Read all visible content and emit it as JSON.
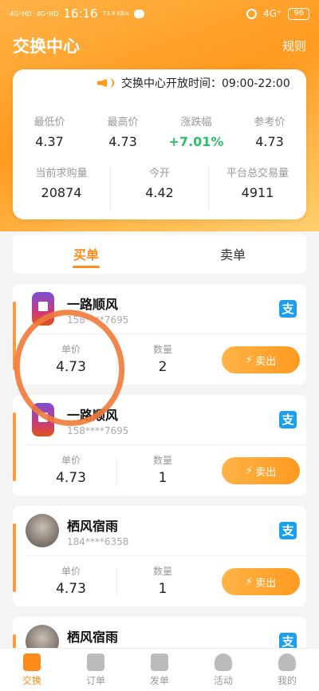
{
  "status": {
    "net1": "4G⁺HD",
    "net2": "4G⁺HD",
    "time": "16:16",
    "speed": "73.9 KB/s",
    "net3": "4G⁺",
    "battery": "96"
  },
  "header": {
    "title": "交换中心",
    "rules": "规则"
  },
  "notice": "交换中心开放时间：09:00-22:00",
  "stats": {
    "row1": [
      {
        "label": "最低价",
        "value": "4.37"
      },
      {
        "label": "最高价",
        "value": "4.73"
      },
      {
        "label": "涨跌幅",
        "value": "+7.01%"
      },
      {
        "label": "参考价",
        "value": "4.73"
      }
    ],
    "row2": [
      {
        "label": "当前求购量",
        "value": "20874"
      },
      {
        "label": "今开",
        "value": "4.42"
      },
      {
        "label": "平台总交易量",
        "value": "4911"
      }
    ]
  },
  "tabs": {
    "buy": "买单",
    "sell": "卖单"
  },
  "orders": [
    {
      "name": "一路顺风",
      "id": "158****7695",
      "price_label": "单价",
      "price": "4.73",
      "qty_label": "数量",
      "qty": "2",
      "action": "卖出",
      "pay_icon": "支"
    },
    {
      "name": "一路顺风",
      "id": "158****7695",
      "price_label": "单价",
      "price": "4.73",
      "qty_label": "数量",
      "qty": "1",
      "action": "卖出",
      "pay_icon": "支"
    },
    {
      "name": "栖风宿雨",
      "id": "184****6358",
      "price_label": "单价",
      "price": "4.73",
      "qty_label": "数量",
      "qty": "1",
      "action": "卖出",
      "pay_icon": "支"
    },
    {
      "name": "栖风宿雨",
      "id": "",
      "pay_icon": "支"
    }
  ],
  "tabbar": [
    {
      "label": "交换"
    },
    {
      "label": "订单"
    },
    {
      "label": "发单"
    },
    {
      "label": "活动"
    },
    {
      "label": "我的"
    }
  ],
  "colors": {
    "accent": "#ff8c1a",
    "green": "#2bbf6a",
    "alipay": "#1a9ff0"
  }
}
